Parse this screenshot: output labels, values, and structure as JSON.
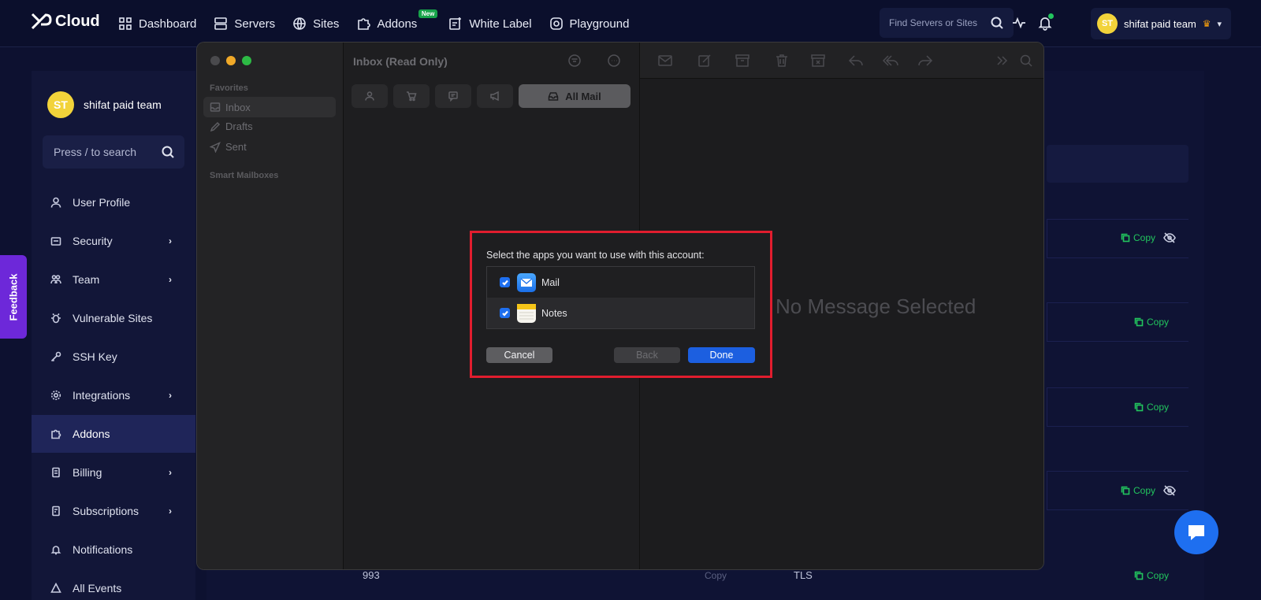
{
  "topnav": {
    "brand": "Cloud",
    "items": [
      {
        "label": "Dashboard",
        "icon": "dashboard-icon"
      },
      {
        "label": "Servers",
        "icon": "server-icon"
      },
      {
        "label": "Sites",
        "icon": "globe-icon"
      },
      {
        "label": "Addons",
        "icon": "puzzle-icon",
        "badge": "New"
      },
      {
        "label": "White Label",
        "icon": "white-label-icon"
      },
      {
        "label": "Playground",
        "icon": "playground-icon"
      }
    ],
    "search_placeholder": "Find Servers or Sites",
    "user": {
      "initials": "ST",
      "name": "shifat paid team"
    }
  },
  "sidebar": {
    "user": {
      "initials": "ST",
      "name": "shifat paid team"
    },
    "search_placeholder": "Press / to search",
    "items": [
      {
        "label": "User Profile",
        "has_submenu": false
      },
      {
        "label": "Security",
        "has_submenu": true
      },
      {
        "label": "Team",
        "has_submenu": true
      },
      {
        "label": "Vulnerable Sites",
        "has_submenu": false
      },
      {
        "label": "SSH Key",
        "has_submenu": false
      },
      {
        "label": "Integrations",
        "has_submenu": true
      },
      {
        "label": "Addons",
        "has_submenu": false,
        "active": true
      },
      {
        "label": "Billing",
        "has_submenu": true
      },
      {
        "label": "Subscriptions",
        "has_submenu": true
      },
      {
        "label": "Notifications",
        "has_submenu": false
      },
      {
        "label": "All Events",
        "has_submenu": false
      }
    ]
  },
  "feedback_label": "Feedback",
  "background": {
    "copy_label": "Copy",
    "bottom_row": {
      "port": "993",
      "copy": "Copy",
      "security": "TLS"
    }
  },
  "mail_window": {
    "title": "Inbox (Read Only)",
    "sections": {
      "favorites": "Favorites",
      "smart": "Smart Mailboxes"
    },
    "mailboxes": [
      "Inbox",
      "Drafts",
      "Sent"
    ],
    "filter_all": "All Mail",
    "no_message": "No Message Selected"
  },
  "dialog": {
    "prompt": "Select the apps you want to use with this account:",
    "apps": [
      {
        "name": "Mail",
        "checked": true
      },
      {
        "name": "Notes",
        "checked": true
      }
    ],
    "buttons": {
      "cancel": "Cancel",
      "back": "Back",
      "done": "Done"
    }
  },
  "colors": {
    "accent": "#1c5fe0",
    "highlight": "#e11d2e",
    "copy_green": "#22c55e",
    "feedback": "#6d28d9"
  }
}
